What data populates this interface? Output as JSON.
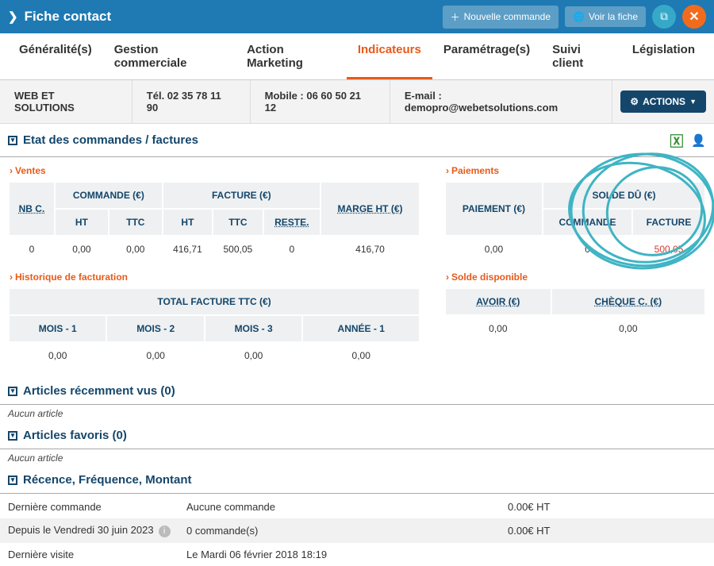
{
  "header": {
    "title": "Fiche contact",
    "new_order": "Nouvelle commande",
    "view": "Voir la fiche"
  },
  "tabs": {
    "general": "Généralité(s)",
    "gestion": "Gestion commerciale",
    "marketing": "Action Marketing",
    "indicateurs": "Indicateurs",
    "param": "Paramétrage(s)",
    "suivi": "Suivi client",
    "legis": "Législation"
  },
  "info": {
    "company": "WEB ET SOLUTIONS",
    "tel": "Tél. 02 35 78 11 90",
    "mobile": "Mobile : 06 60 50 21 12",
    "email": "E-mail : demopro@webetsolutions.com",
    "actions": "ACTIONS"
  },
  "section_orders": "Etat des commandes / factures",
  "ventes": {
    "title": "Ventes",
    "h_nbc": "NB C.",
    "h_commande": "COMMANDE (€)",
    "h_facture": "FACTURE (€)",
    "h_ht": "HT",
    "h_ttc": "TTC",
    "h_reste": "RESTE.",
    "h_marge": "MARGE HT (€)",
    "r_nbc": "0",
    "r_c_ht": "0,00",
    "r_c_ttc": "0,00",
    "r_f_ht": "416,71",
    "r_f_ttc": "500,05",
    "r_reste": "0",
    "r_marge": "416,70"
  },
  "paiements": {
    "title": "Paiements",
    "h_paiement": "PAIEMENT (€)",
    "h_solde": "SOLDE DÛ (€)",
    "h_commande": "COMMANDE",
    "h_facture": "FACTURE",
    "r_pai": "0,00",
    "r_cmd": "0",
    "r_fact": "500,05"
  },
  "hist": {
    "title": "Historique de facturation",
    "h_total": "TOTAL FACTURE TTC (€)",
    "h_m1": "MOIS - 1",
    "h_m2": "MOIS - 2",
    "h_m3": "MOIS - 3",
    "h_a1": "ANNÉE - 1",
    "r_m1": "0,00",
    "r_m2": "0,00",
    "r_m3": "0,00",
    "r_a1": "0,00"
  },
  "solde": {
    "title": "Solde disponible",
    "h_avoir": "AVOIR (€)",
    "h_cheque": "CHÈQUE C.  (€)",
    "r_avoir": "0,00",
    "r_cheque": "0,00"
  },
  "recent": {
    "title": "Articles récemment vus (0)",
    "empty": "Aucun article"
  },
  "fav": {
    "title": "Articles favoris (0)",
    "empty": "Aucun article"
  },
  "rfm": {
    "title": "Récence, Fréquence, Montant",
    "r1_l": "Dernière commande",
    "r1_m": "Aucune commande",
    "r1_r": "0.00€ HT",
    "r2_l": "Depuis le Vendredi 30 juin 2023",
    "r2_m": "0 commande(s)",
    "r2_r": "0.00€ HT",
    "r3_l": "Dernière visite",
    "r3_m": "Le Mardi 06 février 2018 18:19"
  }
}
